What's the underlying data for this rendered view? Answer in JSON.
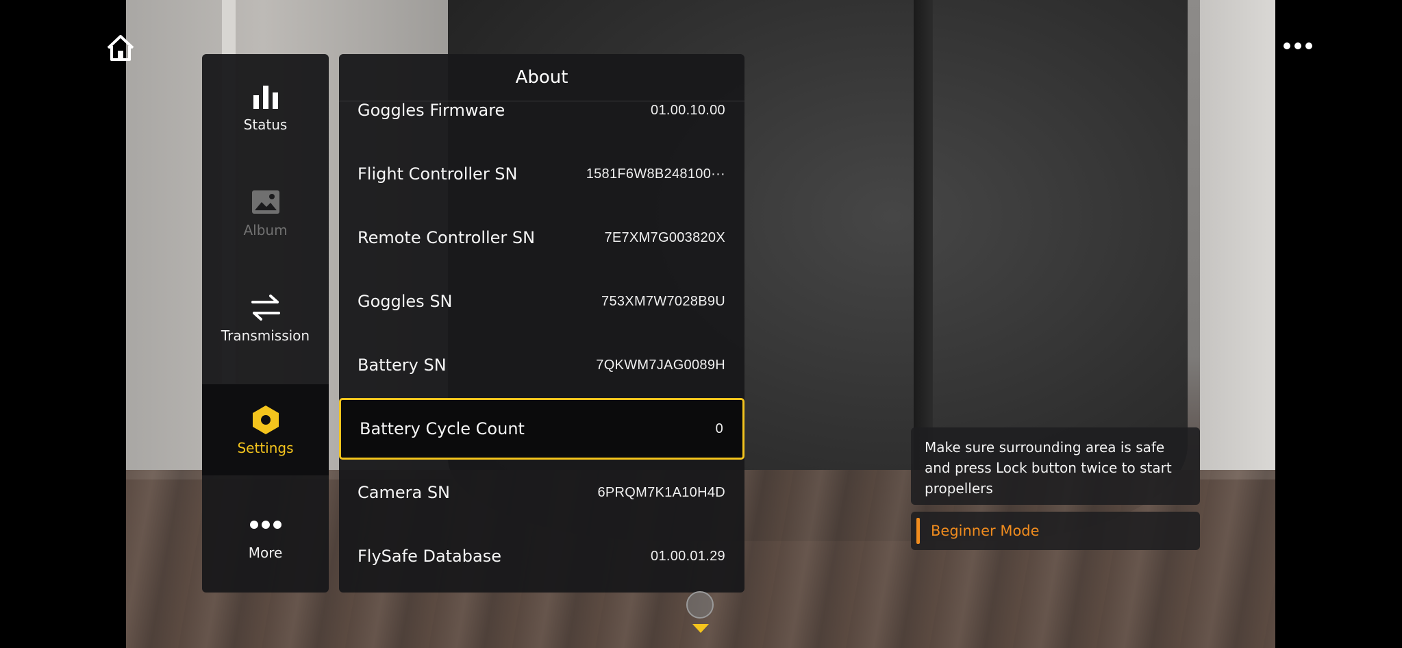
{
  "nav": {
    "items": [
      {
        "label": "Status",
        "icon": "bar-chart-icon",
        "state": "normal"
      },
      {
        "label": "Album",
        "icon": "image-icon",
        "state": "disabled"
      },
      {
        "label": "Transmission",
        "icon": "swap-arrows-icon",
        "state": "normal"
      },
      {
        "label": "Settings",
        "icon": "hexagon-settings-icon",
        "state": "active"
      },
      {
        "label": "More",
        "icon": "dots-icon",
        "state": "normal"
      }
    ]
  },
  "panel": {
    "title": "About",
    "rows": [
      {
        "label": "Goggles Firmware",
        "value": "01.00.10.00"
      },
      {
        "label": "Flight Controller SN",
        "value": "1581F6W8B248100···"
      },
      {
        "label": "Remote Controller SN",
        "value": "7E7XM7G003820X"
      },
      {
        "label": "Goggles SN",
        "value": "753XM7W7028B9U"
      },
      {
        "label": "Battery SN",
        "value": "7QKWM7JAG0089H"
      },
      {
        "label": "Battery Cycle Count",
        "value": "0"
      },
      {
        "label": "Camera SN",
        "value": "6PRQM7K1A10H4D"
      },
      {
        "label": "FlySafe Database",
        "value": "01.00.01.29"
      }
    ],
    "selected_row": "Battery Cycle Count"
  },
  "notice": {
    "text": "Make sure surrounding area is safe and press Lock button twice to start propellers"
  },
  "mode": {
    "label": "Beginner Mode"
  },
  "colors": {
    "accent": "#f4c41d",
    "mode_accent": "#f08c1e",
    "panel_bg": "#18181a"
  }
}
